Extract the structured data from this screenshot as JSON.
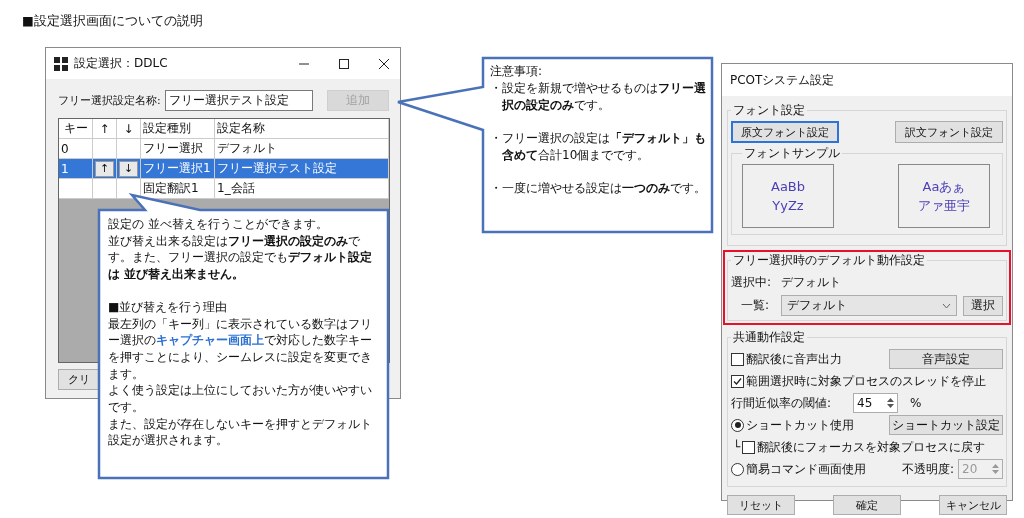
{
  "page_title": "■設定選択画面についての説明",
  "list_window": {
    "title": "設定選択：DDLC",
    "name_label": "フリー選択設定名称:",
    "name_value": "フリー選択テスト設定",
    "add_button": {
      "label": "追加",
      "disabled": true
    },
    "columns": [
      "キー",
      "↑",
      "↓",
      "設定種別",
      "設定名称"
    ],
    "rows": [
      {
        "key": "0",
        "type": "フリー選択",
        "name": "デフォルト",
        "selected": false
      },
      {
        "key": "1",
        "up": "↑",
        "down": "↓",
        "type": "フリー選択1",
        "name": "フリー選択テスト設定",
        "selected": true
      },
      {
        "type": "固定翻訳1",
        "name": "1_会話",
        "selected": false
      }
    ],
    "clear_button": "クリ"
  },
  "sort_note": {
    "paragraphs": [
      {
        "kind": "text",
        "text": "設定の 並べ替えを行うことができます。"
      },
      {
        "kind": "text",
        "text": "並び替え出来る設定は**フリー選択の設定のみ**です。また、フリー選択の設定でも**デフォルト設定は 並び替え出来ません。**"
      },
      {
        "kind": "heading",
        "text": "■並び替えを行う理由"
      },
      {
        "kind": "link",
        "before": "最左列の「キー列」に表示されている数字はフリー選択の",
        "link": "キャプチャー画面上",
        "after": "で対応した数字キーを押すことにより、シームレスに設定を変更できます。"
      },
      {
        "kind": "text",
        "text": "よく使う設定は上位にしておいた方が使いやすいです。"
      },
      {
        "kind": "text",
        "text": "また、設定が存在しないキーを押すとデフォルト設定が選択されます。"
      }
    ]
  },
  "limit_note": {
    "paragraphs": [
      {
        "kind": "heading",
        "text": "注意事項:"
      },
      {
        "kind": "bullet",
        "text": "・設定を新規で増やせるものは**フリー選択の設定のみ**です。"
      },
      {
        "kind": "bullet",
        "text": "・フリー選択の設定は**「デフォルト」も含めて**合計10個までです。"
      },
      {
        "kind": "bullet",
        "text": "・一度に増やせる設定は**一つのみ**です。"
      }
    ]
  },
  "settings_window": {
    "title": "PCOTシステム設定",
    "font_group": {
      "title": "フォント設定",
      "buttons": [
        {
          "label": "原文フォント設定",
          "focused": true
        },
        {
          "label": "訳文フォント設定",
          "focused": false
        }
      ],
      "sample_title": "フォントサンプル",
      "samples": [
        [
          "AaBb",
          "YyZz"
        ],
        [
          "Aaあぁ",
          "アァ亜宇"
        ]
      ]
    },
    "default_group": {
      "title": "フリー選択時のデフォルト動作設定",
      "highlighted": true,
      "current_label": "選択中:",
      "current_value": "デフォルト",
      "list_label": "一覧:",
      "list_value": "デフォルト",
      "select_button": "選択"
    },
    "common_group": {
      "title": "共通動作設定",
      "options": [
        {
          "kind": "checkbox",
          "label": "翻訳後に音声出力",
          "checked": false,
          "button": "音声設定"
        },
        {
          "kind": "checkbox",
          "label": "範囲選択時に対象プロセスのスレッドを停止",
          "checked": true
        },
        {
          "kind": "spinner",
          "label": "行間近似率の閾値:",
          "value": "45",
          "unit": "%"
        },
        {
          "kind": "radio",
          "label": "ショートカット使用",
          "selected": true,
          "button": "ショートカット設定"
        },
        {
          "kind": "subcheckbox",
          "prefix": "└",
          "label": "翻訳後にフォーカスを対象プロセスに戻す",
          "checked": false
        },
        {
          "kind": "radio",
          "label": "簡易コマンド画面使用",
          "selected": false,
          "spinner_label": "不透明度:",
          "spinner_value": "20",
          "spinner_disabled": true
        }
      ]
    },
    "footer_buttons": [
      "リセット",
      "確定",
      "キャンセル"
    ]
  }
}
